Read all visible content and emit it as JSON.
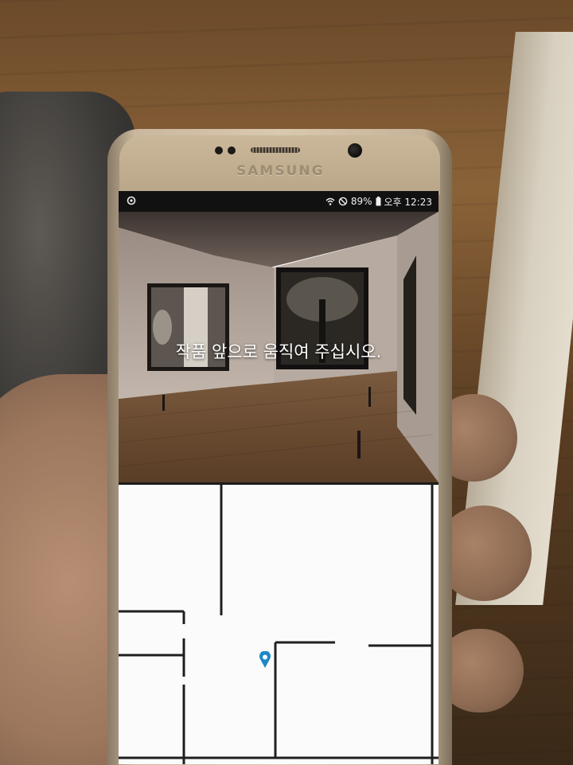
{
  "device": {
    "brand": "SAMSUNG"
  },
  "status_bar": {
    "battery": "89%",
    "time": "오후 12:23"
  },
  "gallery": {
    "instruction": "작품 앞으로 움직여 주십시오."
  },
  "map": {
    "location_marker_icon": "map-pin-icon",
    "marker_color": "#1e88c7"
  }
}
